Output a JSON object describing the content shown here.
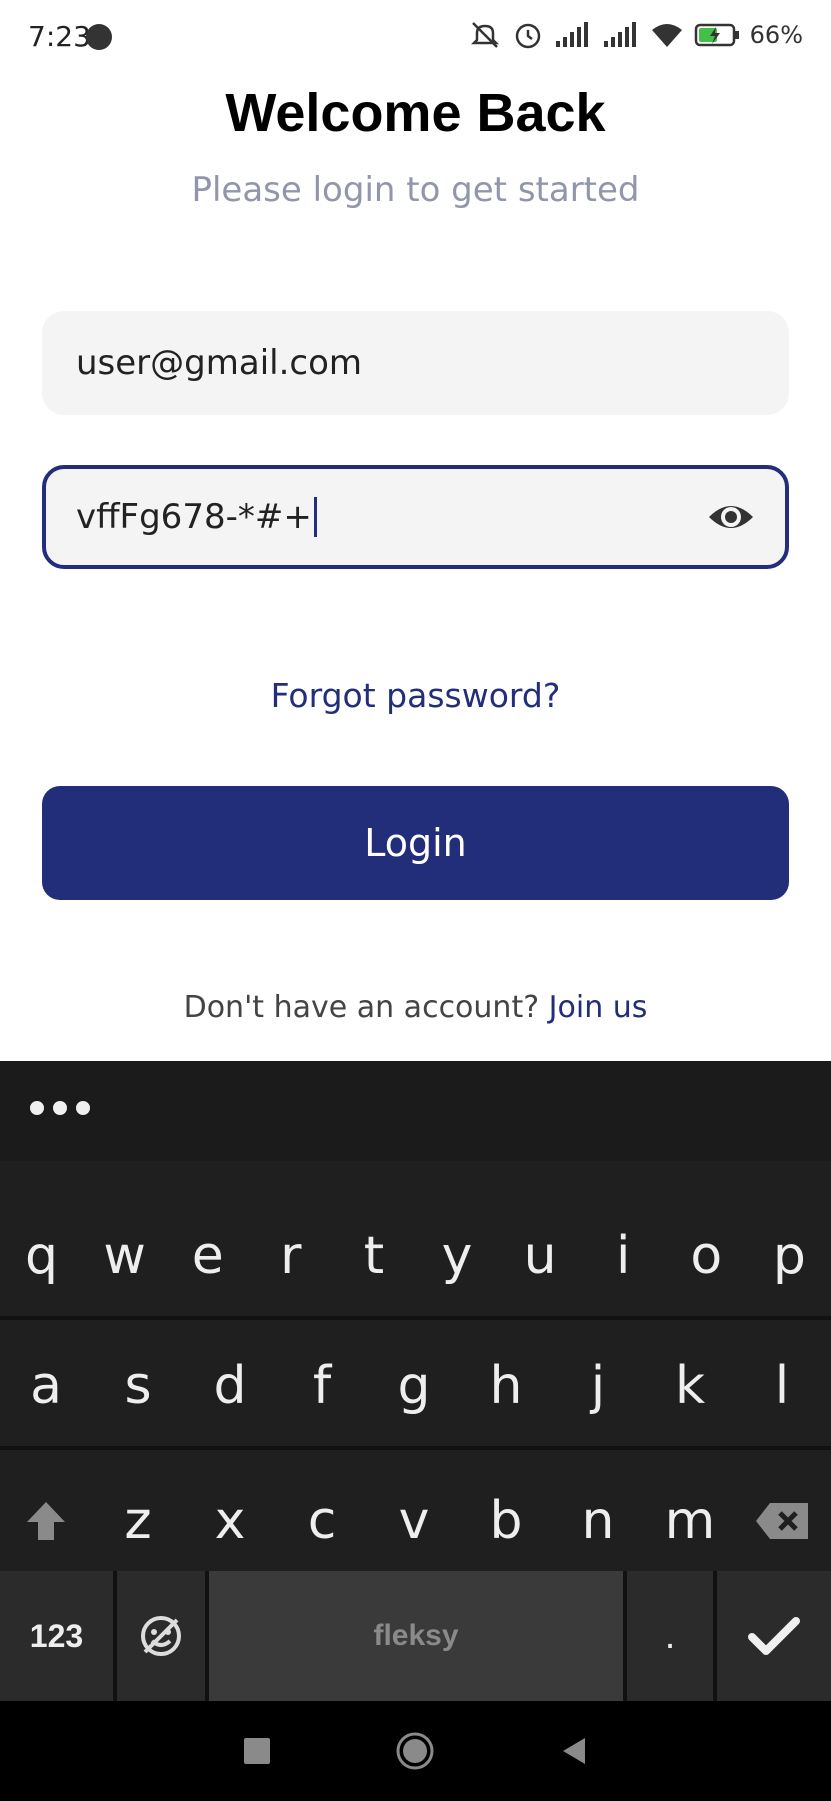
{
  "status_bar": {
    "time": "7:23",
    "battery": "66%"
  },
  "header": {
    "title": "Welcome Back",
    "subtitle": "Please login to get started"
  },
  "form": {
    "email_value": "user@gmail.com",
    "password_value": "vffFg678-*#+",
    "forgot_label": "Forgot password?",
    "login_label": "Login"
  },
  "footer": {
    "prompt": "Don't have an account? ",
    "join_label": "Join us"
  },
  "keyboard": {
    "row1": [
      "q",
      "w",
      "e",
      "r",
      "t",
      "y",
      "u",
      "i",
      "o",
      "p"
    ],
    "row2": [
      "a",
      "s",
      "d",
      "f",
      "g",
      "h",
      "j",
      "k",
      "l"
    ],
    "row3": [
      "z",
      "x",
      "c",
      "v",
      "b",
      "n",
      "m"
    ],
    "numbers_label": "123",
    "space_label": "fleksy",
    "period_label": "."
  },
  "colors": {
    "primary": "#232e7a",
    "field_bg": "#f4f4f5",
    "subtitle": "#9196ab",
    "keyboard_bg": "#1f1f1f"
  }
}
